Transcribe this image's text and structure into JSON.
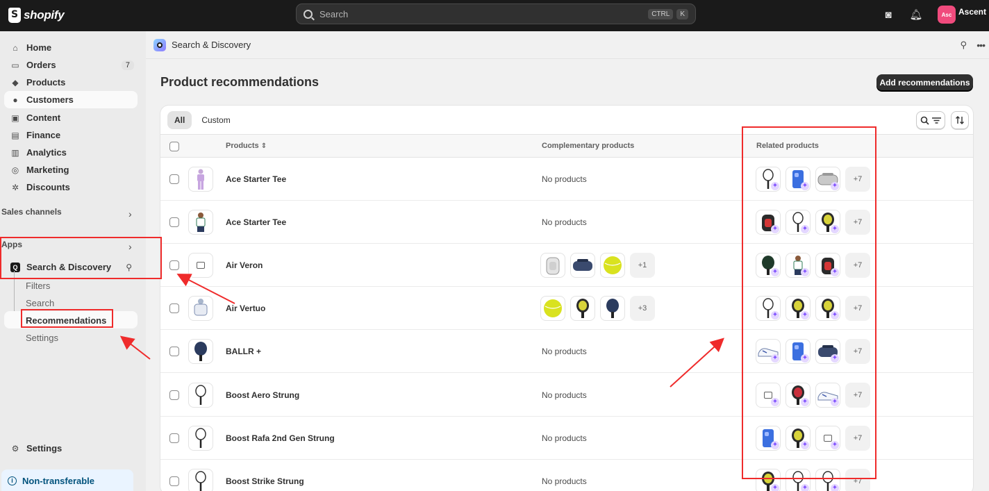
{
  "topbar": {
    "brand": "shopify",
    "search_placeholder": "Search",
    "shortcut_keys": [
      "CTRL",
      "K"
    ],
    "avatar_initials": "Asc",
    "store_name": "Ascent"
  },
  "sidebar": {
    "items": [
      {
        "label": "Home",
        "icon": "home-icon",
        "glyph": "⌂"
      },
      {
        "label": "Orders",
        "icon": "inbox-icon",
        "glyph": "▭",
        "badge": "7"
      },
      {
        "label": "Products",
        "icon": "tag-icon",
        "glyph": "◆"
      },
      {
        "label": "Customers",
        "icon": "person-icon",
        "glyph": "●"
      },
      {
        "label": "Content",
        "icon": "image-icon",
        "glyph": "▣"
      },
      {
        "label": "Finance",
        "icon": "bank-icon",
        "glyph": "▤"
      },
      {
        "label": "Analytics",
        "icon": "bar-chart-icon",
        "glyph": "▥"
      },
      {
        "label": "Marketing",
        "icon": "target-icon",
        "glyph": "◎"
      },
      {
        "label": "Discounts",
        "icon": "discount-icon",
        "glyph": "✲"
      }
    ],
    "sales_channels": "Sales channels",
    "apps": "Apps",
    "app_item": "Search & Discovery",
    "sub_items": [
      "Filters",
      "Search",
      "Recommendations",
      "Settings"
    ],
    "settings": "Settings",
    "notice": "Non-transferable"
  },
  "appbar": {
    "title": "Search & Discovery"
  },
  "page": {
    "title": "Product recommendations",
    "add_button": "Add recommendations",
    "tabs": [
      "All",
      "Custom"
    ],
    "columns": {
      "products": "Products",
      "complementary": "Complementary products",
      "related": "Related products"
    },
    "empty_text": "No products"
  },
  "rows": [
    {
      "name": "Ace Starter Tee",
      "thumb": "purple-outfit",
      "complementary": [],
      "comp_more": "",
      "related": [
        "racket-white",
        "phone-blue",
        "bag-gray"
      ],
      "rel_more": "+7"
    },
    {
      "name": "Ace Starter Tee",
      "thumb": "kid-tee",
      "complementary": [],
      "comp_more": "",
      "related": [
        "backpack-red",
        "racket-white",
        "paddle-yellow"
      ],
      "rel_more": "+7"
    },
    {
      "name": "Air Veron",
      "thumb": "placeholder",
      "complementary": [
        "backpack-white",
        "duffel-navy",
        "ball-yellow"
      ],
      "comp_more": "+1",
      "related": [
        "paddle-green",
        "kid-tee",
        "backpack-red"
      ],
      "rel_more": "+7"
    },
    {
      "name": "Air Vertuo",
      "thumb": "white-hoodie",
      "complementary": [
        "ball-yellow",
        "paddle-yellow",
        "paddle-navy"
      ],
      "comp_more": "+3",
      "related": [
        "racket-white",
        "paddle-yellow",
        "paddle-yellow"
      ],
      "rel_more": "+7"
    },
    {
      "name": "BALLR +",
      "thumb": "paddle-navy",
      "complementary": [],
      "comp_more": "",
      "related": [
        "shoe-white",
        "phone-blue",
        "duffel-navy"
      ],
      "rel_more": "+7"
    },
    {
      "name": "Boost Aero Strung",
      "thumb": "racket-white",
      "complementary": [],
      "comp_more": "",
      "related": [
        "placeholder",
        "paddle-red",
        "shoe-white"
      ],
      "rel_more": "+7"
    },
    {
      "name": "Boost Rafa 2nd Gen Strung",
      "thumb": "racket-white",
      "complementary": [],
      "comp_more": "",
      "related": [
        "phone-blue",
        "paddle-yellow",
        "placeholder"
      ],
      "rel_more": "+7"
    },
    {
      "name": "Boost Strike Strung",
      "thumb": "racket-white",
      "complementary": [],
      "comp_more": "",
      "related": [
        "paddle-yellow",
        "racket-white",
        "racket-white"
      ],
      "rel_more": "+7"
    }
  ],
  "colors": {
    "topbar": "#1a1a1a",
    "annotation": "#ef2b2b",
    "accent": "#8051ff"
  }
}
